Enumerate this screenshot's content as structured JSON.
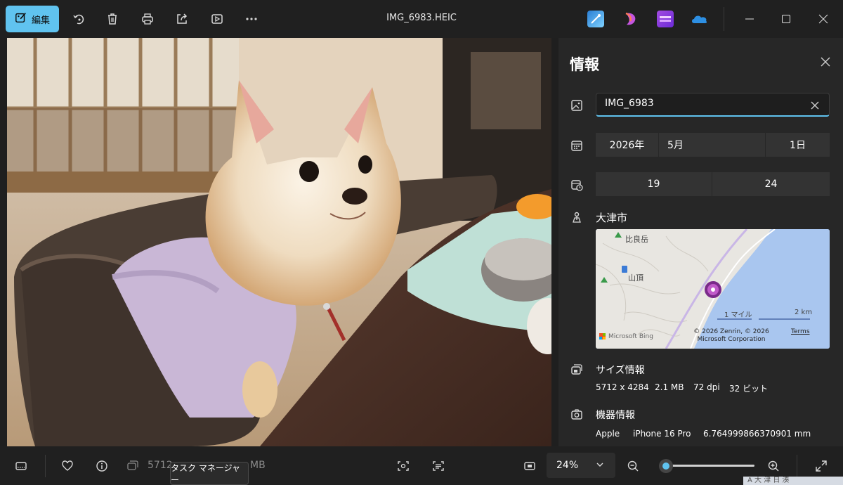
{
  "toolbar": {
    "edit_label": "編集",
    "title": "IMG_6983.HEIC",
    "icons": [
      "edit-icon",
      "rotate-icon",
      "delete-icon",
      "print-icon",
      "share-icon",
      "slideshow-icon",
      "more-icon"
    ],
    "apps": [
      "designer-icon",
      "clipchamp-icon",
      "video-editor-icon",
      "onedrive-icon"
    ]
  },
  "info_panel": {
    "title": "情報",
    "file_name": "IMG_6983",
    "date": {
      "year": "2026年",
      "month": "5月",
      "day": "1日"
    },
    "time": {
      "hour": "19",
      "minute": "24"
    },
    "location": "大津市",
    "map": {
      "label_mountain": "比良岳",
      "label_summit": "山頂",
      "scale_miles": "1 マイル",
      "scale_km": "2 km",
      "provider": "Microsoft Bing",
      "copyright": "© 2026 Zenrin, © 2026 Microsoft Corporation",
      "terms": "Terms"
    },
    "size_section": {
      "title": "サイズ情報",
      "dimensions": "5712 x 4284",
      "file_size": "2.1 MB",
      "dpi": "72 dpi",
      "bit_depth": "32 ビット"
    },
    "device_section": {
      "title": "機器情報",
      "make": "Apple",
      "model": "iPhone 16 Pro",
      "focal_length": "6.764999866370901 mm"
    }
  },
  "bottombar": {
    "dimensions_partial": "5712",
    "size_partial": "MB",
    "zoom": "24%",
    "zoom_fraction": 0.06,
    "tooltip": "タスク マネージャー"
  },
  "taskbar_peek": "A  大  津  日 湊"
}
